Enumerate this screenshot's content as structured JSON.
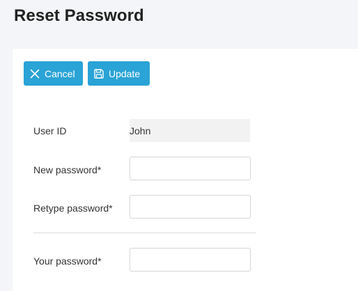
{
  "page": {
    "title": "Reset Password"
  },
  "toolbar": {
    "cancel_label": "Cancel",
    "update_label": "Update",
    "cancel_icon": "close-icon",
    "update_icon": "save-icon"
  },
  "form": {
    "user_id": {
      "label": "User ID",
      "value": "John"
    },
    "new_password": {
      "label": "New password*",
      "value": "",
      "placeholder": ""
    },
    "retype_password": {
      "label": "Retype password*",
      "value": "",
      "placeholder": ""
    },
    "your_password": {
      "label": "Your password*",
      "value": "",
      "placeholder": ""
    }
  },
  "colors": {
    "accent": "#2aa3d6",
    "page_background": "#f3f5f8",
    "card_background": "#ffffff",
    "readonly_background": "#f2f2f2"
  }
}
